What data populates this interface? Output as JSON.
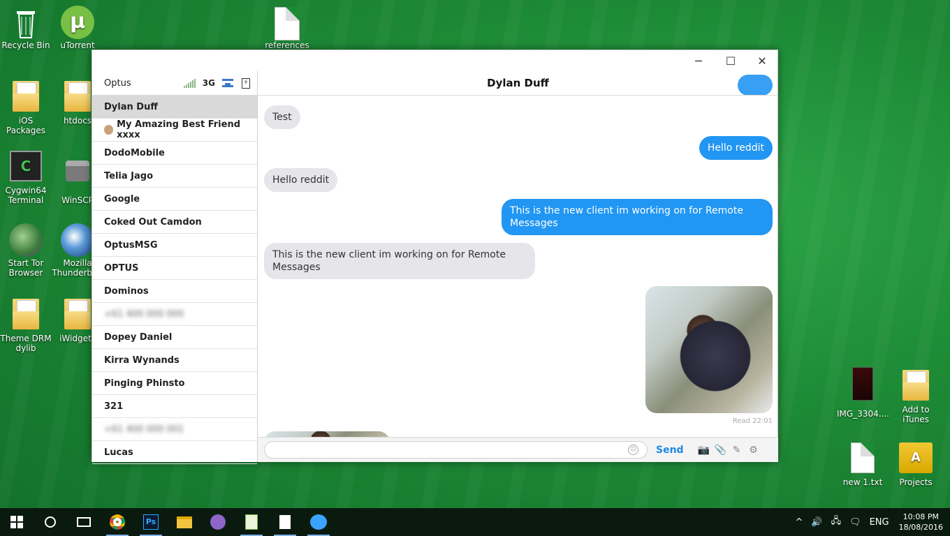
{
  "desktop": {
    "icons_left": [
      {
        "label": "Recycle Bin",
        "icon": "recycle-bin-icon"
      },
      {
        "label": "uTorrent",
        "icon": "utorrent-icon"
      },
      {
        "label": "iOS Packages",
        "icon": "folder-icon"
      },
      {
        "label": "htdocs",
        "icon": "folder-icon"
      },
      {
        "label": "Cygwin64 Terminal",
        "icon": "terminal-icon"
      },
      {
        "label": "WinSCP",
        "icon": "winscp-icon"
      },
      {
        "label": "Start Tor Browser",
        "icon": "tor-icon"
      },
      {
        "label": "Mozilla Thunderbird",
        "icon": "thunderbird-icon"
      },
      {
        "label": "Theme DRM dylib",
        "icon": "folder-icon"
      },
      {
        "label": "iWidgets",
        "icon": "folder-icon"
      }
    ],
    "icons_right": [
      {
        "label": "IMG_3304....",
        "icon": "image-file-icon"
      },
      {
        "label": "Add to iTunes",
        "icon": "folder-icon"
      },
      {
        "label": "new 1.txt",
        "icon": "text-file-icon"
      },
      {
        "label": "Projects",
        "icon": "projects-folder-icon"
      }
    ],
    "top_file_label": "references"
  },
  "window": {
    "controls": {
      "minimize": "─",
      "maximize": "☐",
      "close": "✕"
    },
    "status_bar": {
      "carrier": "Optus",
      "network": "3G",
      "battery_glyph": "⚡"
    },
    "contacts": [
      {
        "name": "Dylan Duff",
        "active": true
      },
      {
        "name": "My Amazing Best Friend xxxx",
        "emoji": true
      },
      {
        "name": "DodoMobile"
      },
      {
        "name": "Telia Jago"
      },
      {
        "name": "Google"
      },
      {
        "name": "Coked Out Camdon"
      },
      {
        "name": "OptusMSG"
      },
      {
        "name": "OPTUS"
      },
      {
        "name": "Dominos"
      },
      {
        "name": "+61 400 000 000",
        "blurred": true
      },
      {
        "name": "Dopey Daniel"
      },
      {
        "name": "Kirra Wynands"
      },
      {
        "name": "Pinging Phinsto"
      },
      {
        "name": "321"
      },
      {
        "name": "+61 400 000 001",
        "blurred": true
      },
      {
        "name": "Lucas"
      }
    ],
    "chat": {
      "title": "Dylan Duff",
      "messages": [
        {
          "direction": "in",
          "text": "Test"
        },
        {
          "direction": "out",
          "text": "Hello reddit"
        },
        {
          "direction": "in",
          "text": "Hello reddit"
        },
        {
          "direction": "out",
          "text": "This is the new client im working on for Remote Messages"
        },
        {
          "direction": "in",
          "text": "This is the new client im working on for Remote Messages"
        },
        {
          "direction": "out",
          "type": "photo"
        }
      ],
      "read_receipt": "Read 22:01",
      "composer": {
        "placeholder": "",
        "send_label": "Send",
        "smiley": "☺",
        "camera": "📷",
        "attach": "📎",
        "compose": "✎",
        "settings": "⚙"
      }
    }
  },
  "taskbar": {
    "apps": [
      "start-icon",
      "cortana-icon",
      "task-view-icon",
      "chrome-icon",
      "photoshop-icon",
      "file-explorer-icon",
      "github-icon",
      "notepad-plus-icon",
      "file-icon",
      "messages-icon"
    ],
    "photoshop_label": "Ps",
    "tray": {
      "chevron": "^",
      "volume": "🔊",
      "network": "🖧",
      "action_center": "🗨",
      "language": "ENG",
      "time": "10:08 PM",
      "date": "18/08/2016"
    }
  }
}
